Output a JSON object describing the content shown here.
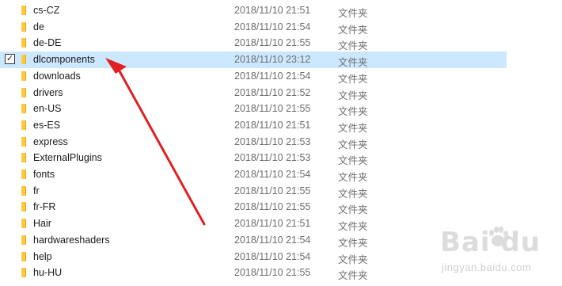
{
  "file_list": {
    "rows": [
      {
        "name": "cs-CZ",
        "date": "2018/11/10 21:51",
        "type": "文件夹",
        "selected": false
      },
      {
        "name": "de",
        "date": "2018/11/10 21:54",
        "type": "文件夹",
        "selected": false
      },
      {
        "name": "de-DE",
        "date": "2018/11/10 21:55",
        "type": "文件夹",
        "selected": false
      },
      {
        "name": "dlcomponents",
        "date": "2018/11/10 23:12",
        "type": "文件夹",
        "selected": true
      },
      {
        "name": "downloads",
        "date": "2018/11/10 21:54",
        "type": "文件夹",
        "selected": false
      },
      {
        "name": "drivers",
        "date": "2018/11/10 21:52",
        "type": "文件夹",
        "selected": false
      },
      {
        "name": "en-US",
        "date": "2018/11/10 21:55",
        "type": "文件夹",
        "selected": false
      },
      {
        "name": "es-ES",
        "date": "2018/11/10 21:51",
        "type": "文件夹",
        "selected": false
      },
      {
        "name": "express",
        "date": "2018/11/10 21:53",
        "type": "文件夹",
        "selected": false
      },
      {
        "name": "ExternalPlugins",
        "date": "2018/11/10 21:53",
        "type": "文件夹",
        "selected": false
      },
      {
        "name": "fonts",
        "date": "2018/11/10 21:54",
        "type": "文件夹",
        "selected": false
      },
      {
        "name": "fr",
        "date": "2018/11/10 21:55",
        "type": "文件夹",
        "selected": false
      },
      {
        "name": "fr-FR",
        "date": "2018/11/10 21:55",
        "type": "文件夹",
        "selected": false
      },
      {
        "name": "Hair",
        "date": "2018/11/10 21:51",
        "type": "文件夹",
        "selected": false
      },
      {
        "name": "hardwareshaders",
        "date": "2018/11/10 21:54",
        "type": "文件夹",
        "selected": false
      },
      {
        "name": "help",
        "date": "2018/11/10 21:54",
        "type": "文件夹",
        "selected": false
      },
      {
        "name": "hu-HU",
        "date": "2018/11/10 21:55",
        "type": "文件夹",
        "selected": false
      }
    ]
  },
  "colors": {
    "selection": "#cce8ff",
    "folder": "#ffc83d",
    "arrow": "#e02020"
  },
  "watermark": {
    "brand": "Bai du",
    "sub": "jingyan.baidu.com"
  },
  "icons": {
    "folder": "folder-icon",
    "check": "checkbox-icon",
    "arrow": "annotation-arrow",
    "paw": "baidu-paw-logo"
  }
}
